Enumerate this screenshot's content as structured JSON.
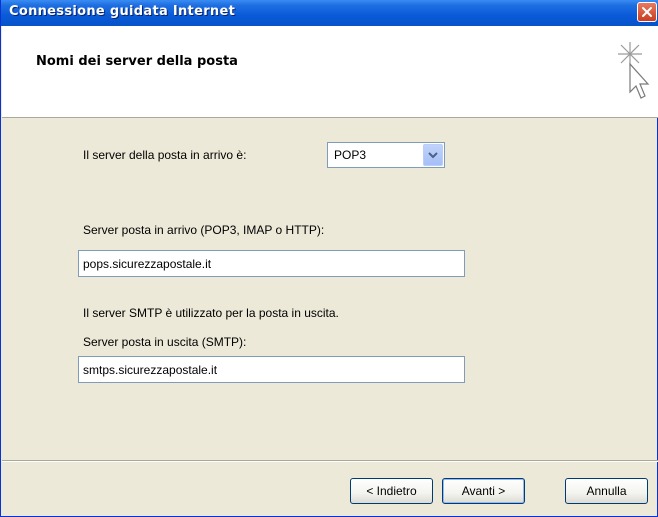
{
  "window": {
    "title": "Connessione guidata Internet"
  },
  "header": {
    "title": "Nomi dei server della posta",
    "icon": "wizard-sparkle-cursor-icon"
  },
  "form": {
    "incoming_type_label": "Il server della posta in arrivo è:",
    "incoming_type_value": "POP3",
    "incoming_server_label": "Server posta in arrivo (POP3, IMAP o HTTP):",
    "incoming_server_value": "pops.sicurezzapostale.it",
    "smtp_note": "Il server SMTP è utilizzato per la posta in uscita.",
    "outgoing_server_label": "Server posta in uscita (SMTP):",
    "outgoing_server_value": "smtps.sicurezzapostale.it"
  },
  "buttons": {
    "back": "< Indietro",
    "next": "Avanti >",
    "cancel": "Annulla"
  },
  "colors": {
    "titlebar": "#0a5ad8",
    "close": "#c83f20",
    "dialog_bg": "#ece9d8"
  }
}
